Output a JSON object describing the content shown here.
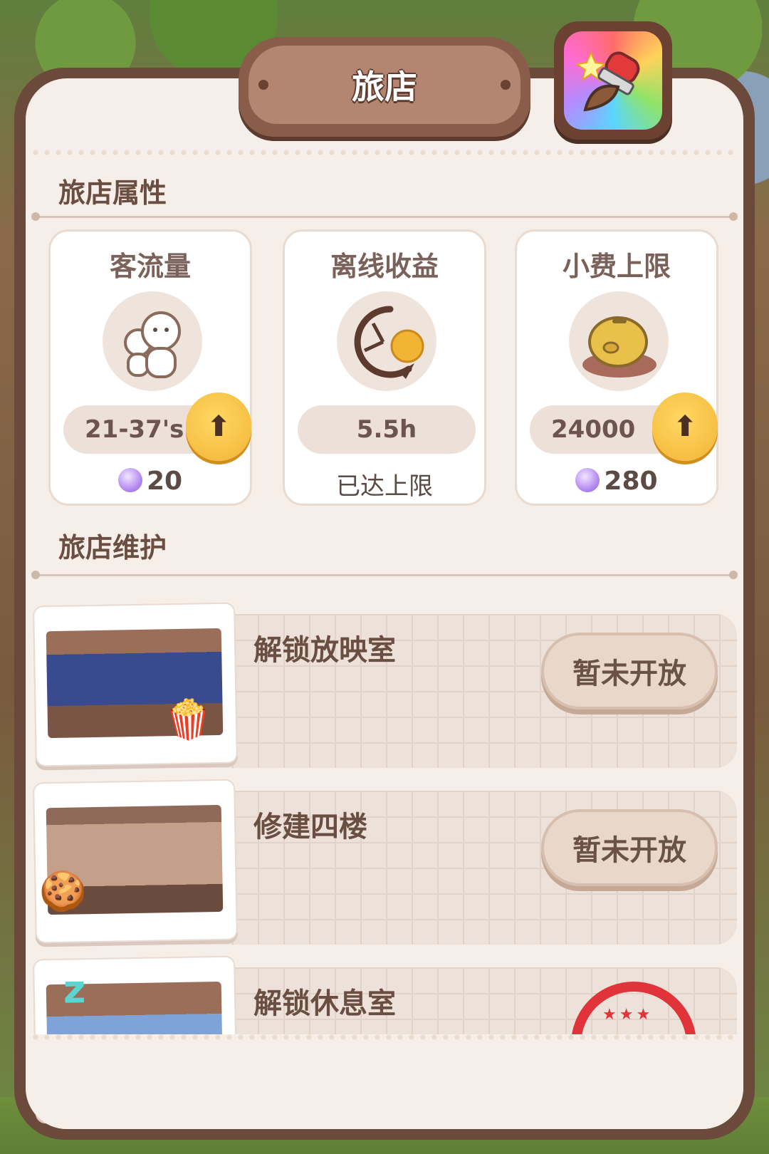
{
  "title": "旅店",
  "decorate_icon": "rainbow-brush-icon",
  "sections": {
    "attributes": "旅店属性",
    "maintenance": "旅店维护"
  },
  "stats": [
    {
      "title": "客流量",
      "icon": "guests-icon",
      "value": "21-37's",
      "cost": "20",
      "upgradable": true
    },
    {
      "title": "离线收益",
      "icon": "offline-clock-icon",
      "value": "5.5h",
      "note": "已达上限",
      "upgradable": false
    },
    {
      "title": "小费上限",
      "icon": "piggy-bank-icon",
      "value": "24000",
      "cost": "280",
      "upgradable": true
    }
  ],
  "tasks": [
    {
      "label": "解锁放映室",
      "button": "暂未开放",
      "thumb": "cinema"
    },
    {
      "label": "修建四楼",
      "button": "暂未开放",
      "thumb": "fourth-floor"
    },
    {
      "label": "解锁休息室",
      "thumb": "rest-room",
      "status": "stamped"
    }
  ],
  "colors": {
    "accent": "#f2b434",
    "panel": "#f6eee8",
    "frame": "#6b4a3b",
    "stamp": "#e0343a"
  }
}
